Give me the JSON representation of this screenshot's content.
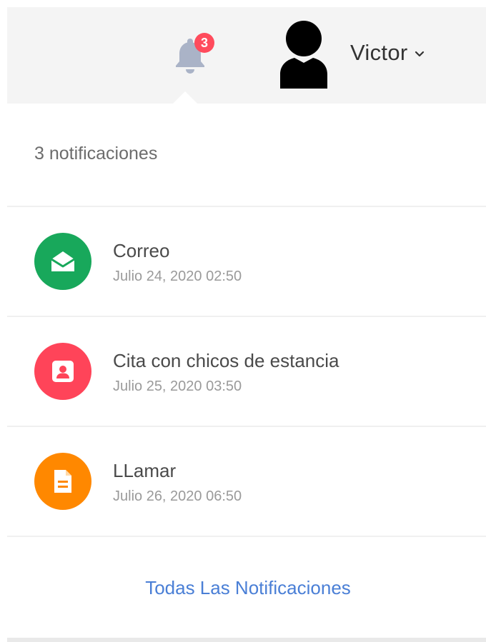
{
  "header": {
    "notification_count": "3",
    "user_name": "Victor"
  },
  "dropdown": {
    "title": "3 notificaciones",
    "items": [
      {
        "title": "Correo",
        "date": "Julio 24, 2020 02:50",
        "icon": "envelope-open-icon",
        "color": "#18a85b"
      },
      {
        "title": "Cita con chicos de estancia",
        "date": "Julio 25, 2020 03:50",
        "icon": "contact-card-icon",
        "color": "#ff4459"
      },
      {
        "title": "LLamar",
        "date": "Julio 26, 2020 06:50",
        "icon": "document-icon",
        "color": "#ff8800"
      }
    ],
    "footer_link": "Todas Las Notificaciones"
  },
  "colors": {
    "bell": "#aab3c7",
    "badge": "#ff4b5c",
    "link": "#4a7fd6",
    "topbar_bg": "#f4f4f4"
  }
}
